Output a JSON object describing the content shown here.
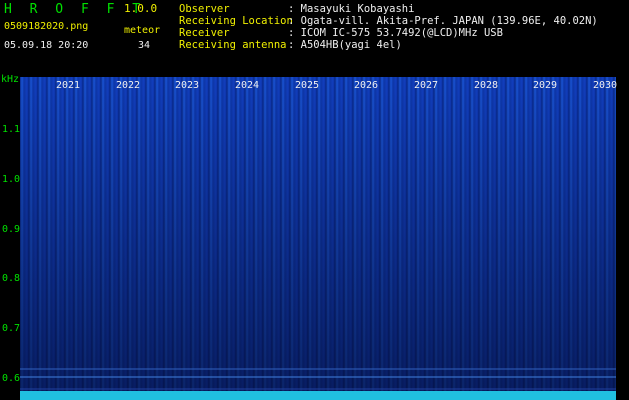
{
  "header": {
    "app_title": "H R O F F T",
    "app_version": "1.0.0",
    "file_name": "0509182020.png",
    "date_time": "05.09.18 20:20",
    "meteor_label": "meteor",
    "meteor_count": "34"
  },
  "info": {
    "observer_label": "Observer",
    "observer_value": ": Masayuki Kobayashi",
    "location_label": "Receiving Location",
    "location_value": ": Ogata-vill. Akita-Pref. JAPAN (139.96E, 40.02N)",
    "receiver_label": "Receiver",
    "receiver_value": ": ICOM IC-575 53.7492(@LCD)MHz USB",
    "antenna_label": "Receiving antenna",
    "antenna_value": ": A504HB(yagi 4el)"
  },
  "axis": {
    "y_unit": "kHz",
    "y_ticks": [
      "1.1",
      "1.0",
      "0.9",
      "0.8",
      "0.7",
      "0.6"
    ],
    "x_ticks": [
      "2021",
      "2022",
      "2023",
      "2024",
      "2025",
      "2026",
      "2027",
      "2028",
      "2029",
      "2030"
    ]
  },
  "colors": {
    "text_green": "#00e000",
    "text_yellow": "#f0f000",
    "background": "#000000"
  }
}
